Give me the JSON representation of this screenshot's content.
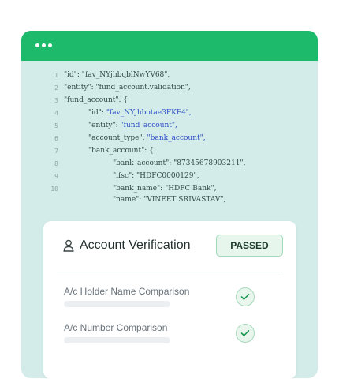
{
  "window": {
    "code_lines": [
      {
        "num": "1",
        "parts": [
          {
            "t": "\"id\": \"fav_NYjhbqblNwYV68\","
          }
        ]
      },
      {
        "num": "2",
        "parts": [
          {
            "t": "\"entity\": \"fund_account.validation\","
          }
        ]
      },
      {
        "num": "3",
        "parts": [
          {
            "t": "\"fund_account\": {"
          }
        ]
      },
      {
        "num": "4",
        "parts": [
          {
            "t": "\"id\": "
          },
          {
            "t": "\"fav_NYjhbotae3FKF4\",",
            "c": "blue"
          }
        ]
      },
      {
        "num": "5",
        "parts": [
          {
            "t": "\"entity\": "
          },
          {
            "t": "\"fund_account\",",
            "c": "blue"
          }
        ]
      },
      {
        "num": "6",
        "parts": [
          {
            "t": "\"account_type\": "
          },
          {
            "t": "\"bank_account\",",
            "c": "blue"
          }
        ]
      },
      {
        "num": "7",
        "parts": [
          {
            "t": "\"bank_account\": {"
          }
        ]
      },
      {
        "num": "8",
        "parts": [
          {
            "t": "\"bank_account\": \"87345678903211\","
          }
        ]
      },
      {
        "num": "9",
        "parts": [
          {
            "t": "\"ifsc\": \"HDFC0000129\","
          }
        ]
      },
      {
        "num": "10",
        "parts": [
          {
            "t": "\"bank_name\": \"HDFC Bank\","
          }
        ]
      },
      {
        "num": "",
        "parts": [
          {
            "t": "\"name\": \"VINEET SRIVASTAV\","
          }
        ]
      }
    ]
  },
  "verification": {
    "title": "Account Verification",
    "status": "PASSED",
    "checks": [
      {
        "label": "A/c Holder Name Comparison"
      },
      {
        "label": "A/c  Number Comparison"
      }
    ]
  },
  "icons": {
    "title_icon": "user-icon",
    "check_icon": "check-icon",
    "window_dots": "more-dots-icon"
  },
  "colors": {
    "titlebar": "#1cba6a",
    "card_background": "#d3ebe9",
    "code_highlight": "#2d4fc7",
    "badge_border": "#9fdab9",
    "badge_background": "#e6f6ec",
    "check_color": "#1a9a52"
  }
}
